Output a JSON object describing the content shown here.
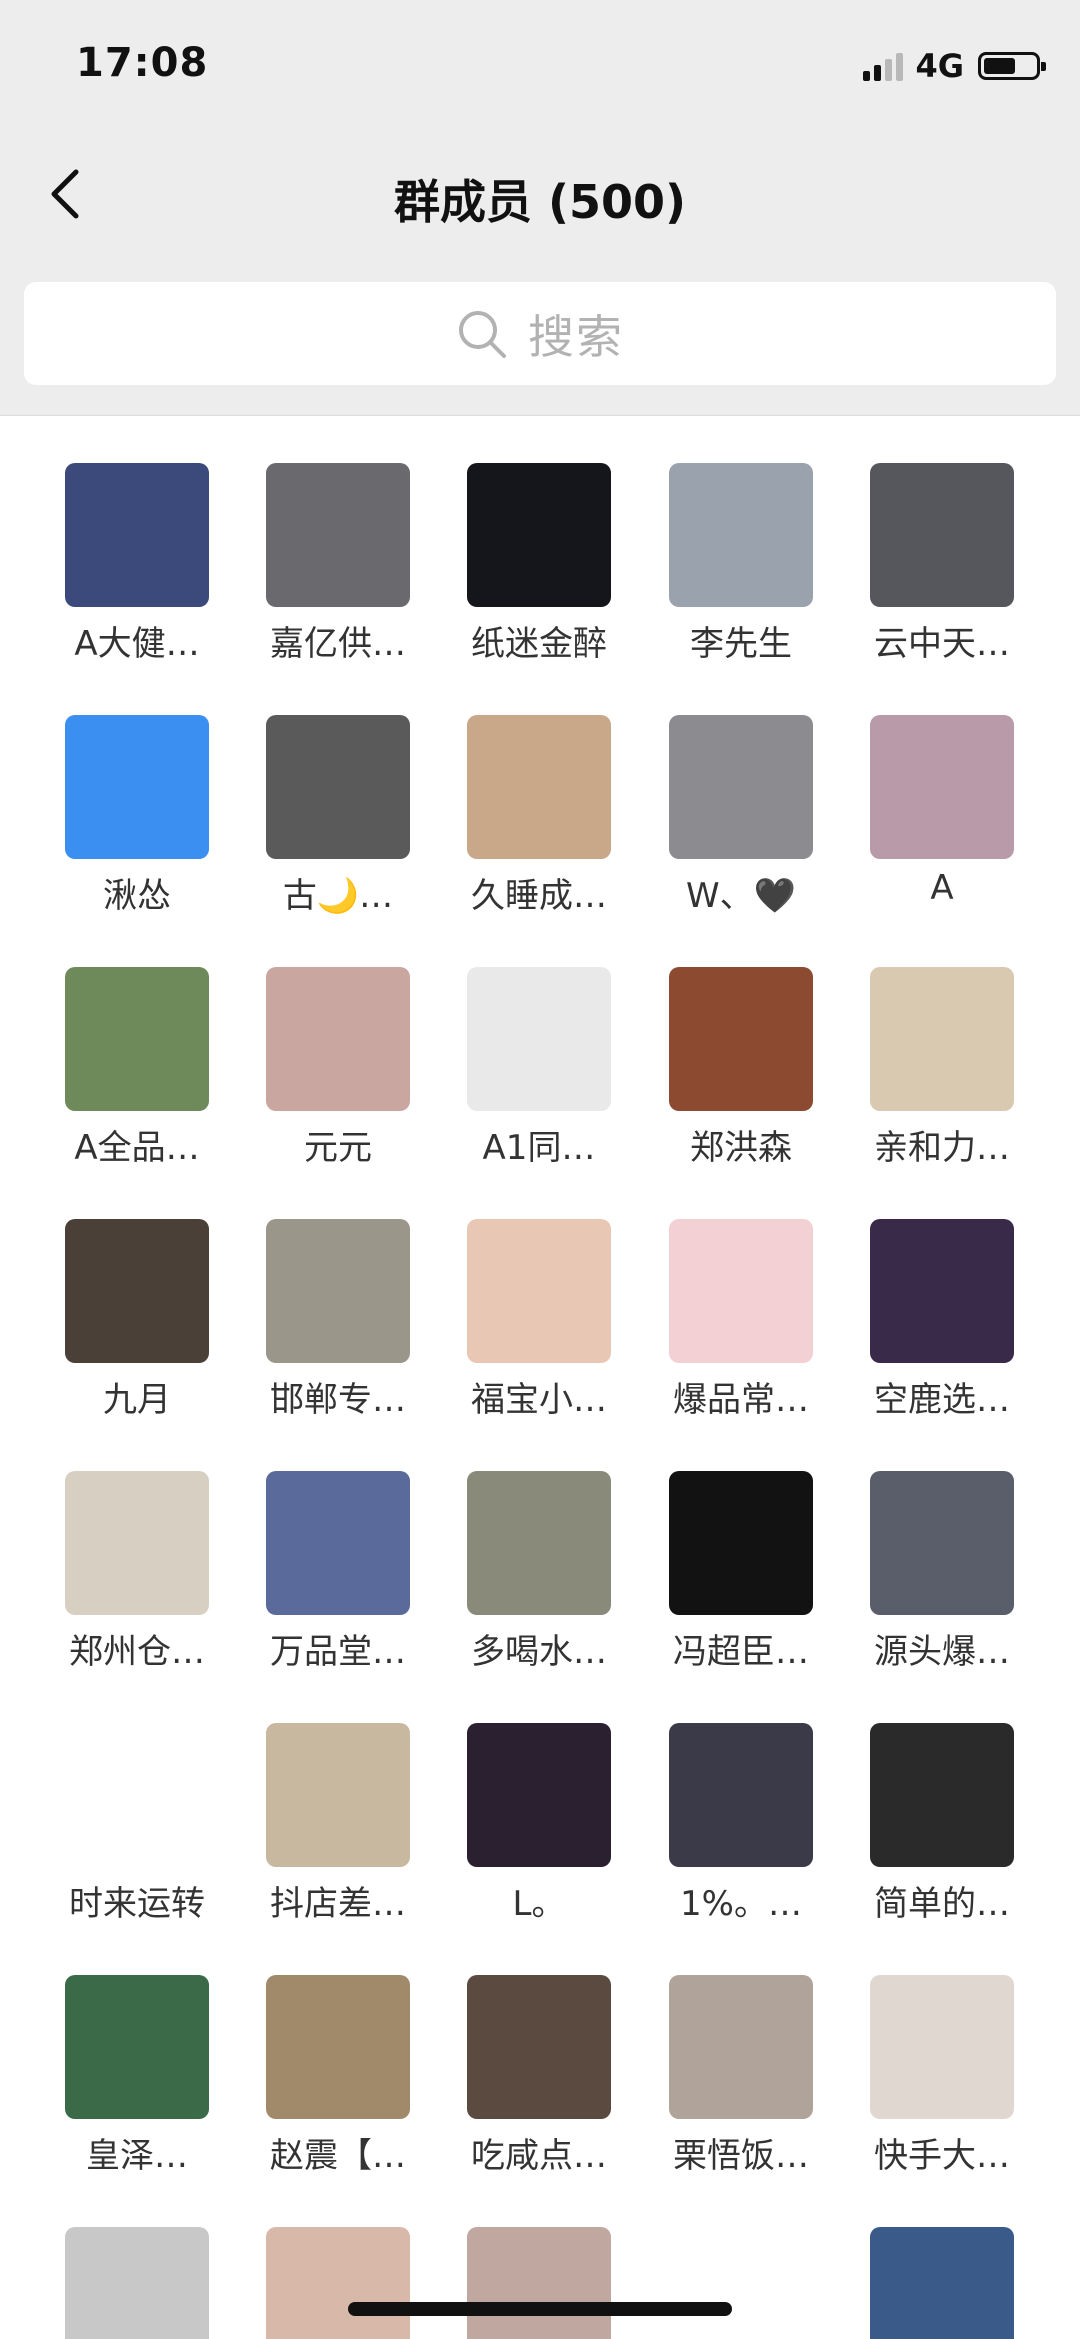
{
  "status_bar": {
    "time": "17:08",
    "network": "4G"
  },
  "nav": {
    "title": "群成员 (500)"
  },
  "search": {
    "placeholder": "搜索"
  },
  "members": [
    {
      "name": "A大健…",
      "color": "#3b4a7a"
    },
    {
      "name": "嘉亿供…",
      "color": "#6a6a6e"
    },
    {
      "name": "纸迷金醉",
      "color": "#15161c"
    },
    {
      "name": "李先生",
      "color": "#9aa3ad"
    },
    {
      "name": "云中天…",
      "color": "#55575c"
    },
    {
      "name": "湫怂",
      "color": "#3b8ff0"
    },
    {
      "name": "古🌙…",
      "color": "#5a5a5a"
    },
    {
      "name": "久睡成…",
      "color": "#c9a88a"
    },
    {
      "name": "W、🖤",
      "color": "#8c8c90"
    },
    {
      "name": "A",
      "color": "#b89aa8"
    },
    {
      "name": "A全品…",
      "color": "#6f8a5a"
    },
    {
      "name": "元元",
      "color": "#c9a7a0"
    },
    {
      "name": "A1同…",
      "color": "#e9e9e9"
    },
    {
      "name": "郑洪森",
      "color": "#8c4a30"
    },
    {
      "name": "亲和力…",
      "color": "#d8c9b0"
    },
    {
      "name": "九月",
      "color": "#4a4038"
    },
    {
      "name": "邯郸专…",
      "color": "#9a9689"
    },
    {
      "name": "福宝小…",
      "color": "#e8c7b4"
    },
    {
      "name": "爆品常…",
      "color": "#f2d0d4"
    },
    {
      "name": "空鹿选…",
      "color": "#3a2a4a"
    },
    {
      "name": "郑州仓…",
      "color": "#d7d0c2"
    },
    {
      "name": "万品堂…",
      "color": "#5a6a9a"
    },
    {
      "name": "多喝水…",
      "color": "#8a8a7a"
    },
    {
      "name": "冯超臣…",
      "color": "#121212"
    },
    {
      "name": "源头爆…",
      "color": "#5a5e6a"
    },
    {
      "name": "时来运转",
      "color": "#ffffff"
    },
    {
      "name": "抖店差…",
      "color": "#c8b8a0"
    },
    {
      "name": "L。",
      "color": "#2a2030"
    },
    {
      "name": "1%。…",
      "color": "#3a3a48"
    },
    {
      "name": "简单的…",
      "color": "#2a2a2a"
    },
    {
      "name": "皇泽…",
      "color": "#3a6a48"
    },
    {
      "name": "赵震【…",
      "color": "#a08a6a"
    },
    {
      "name": "吃咸点…",
      "color": "#5a4a40"
    },
    {
      "name": "栗悟饭…",
      "color": "#b0a49a"
    },
    {
      "name": "快手大…",
      "color": "#e0d8d0"
    },
    {
      "name": "",
      "color": "#c8c8c8"
    },
    {
      "name": "",
      "color": "#d8b8a8"
    },
    {
      "name": "",
      "color": "#c0a8a0"
    },
    {
      "name": "",
      "color": "#ffffff"
    },
    {
      "name": "",
      "color": "#3a5a8a"
    }
  ]
}
